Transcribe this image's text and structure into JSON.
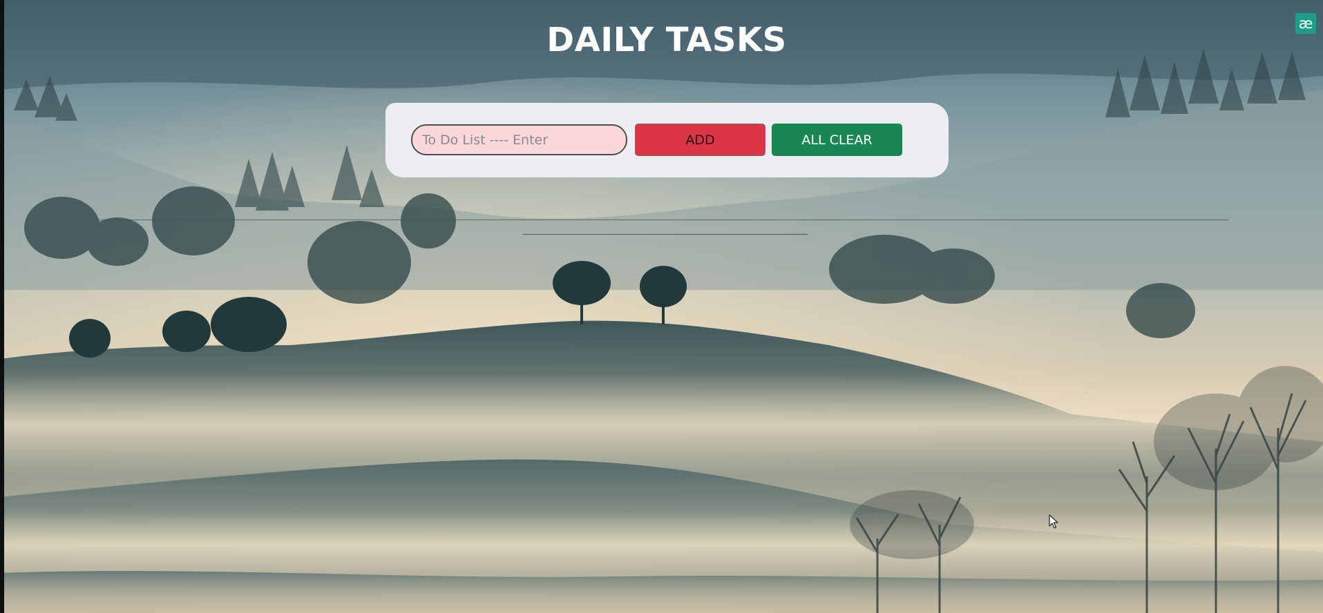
{
  "page": {
    "title": "DAILY TASKS"
  },
  "task_form": {
    "input_value": "",
    "input_placeholder": "To Do List ---- Enter",
    "add_label": "ADD",
    "clear_label": "ALL CLEAR"
  },
  "extension": {
    "icon": "extension-badge-icon",
    "glyph": "æ"
  },
  "colors": {
    "add_button": "#dc3545",
    "clear_button": "#198754",
    "input_background": "#fad7db",
    "card_background": "#eceef1",
    "extension_badge": "#1b9e8a"
  },
  "background": {
    "icon": "misty-hills-landscape"
  }
}
